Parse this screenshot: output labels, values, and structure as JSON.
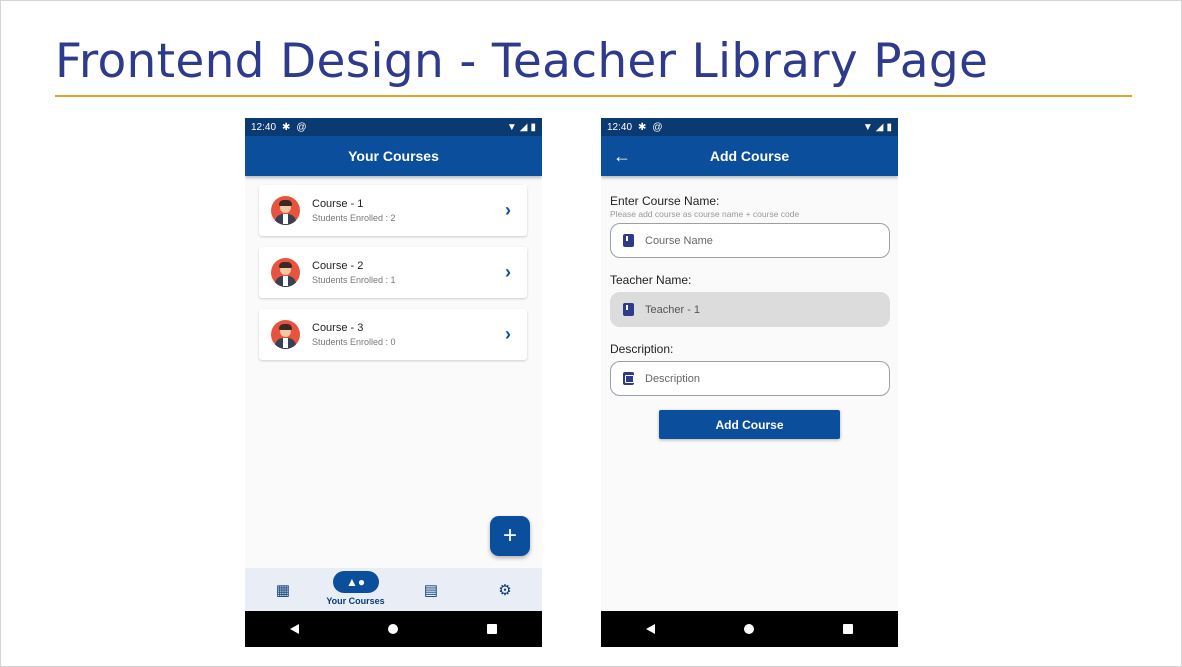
{
  "slide": {
    "title": "Frontend Design - Teacher Library Page",
    "accent_color": "#e2a22a",
    "title_color": "#2e3a8c"
  },
  "status_bar": {
    "time": "12:40",
    "icons": [
      "gear-icon",
      "at-icon",
      "wifi-icon",
      "signal-icon",
      "battery-icon"
    ]
  },
  "courses_screen": {
    "title": "Your Courses",
    "courses": [
      {
        "name": "Course - 1",
        "enrolled": "Students Enrolled : 2"
      },
      {
        "name": "Course - 2",
        "enrolled": "Students Enrolled : 1"
      },
      {
        "name": "Course - 3",
        "enrolled": "Students Enrolled : 0"
      }
    ],
    "fab_label": "+",
    "bottom_nav": {
      "items": [
        {
          "icon": "dashboard-icon",
          "label": ""
        },
        {
          "icon": "shapes-icon",
          "label": "Your Courses",
          "active": true
        },
        {
          "icon": "chat-icon",
          "label": ""
        },
        {
          "icon": "settings-icon",
          "label": ""
        }
      ]
    }
  },
  "add_course_screen": {
    "title": "Add Course",
    "course_name_label": "Enter Course Name:",
    "course_name_hint": "Please add course as course name + course code",
    "course_name_placeholder": "Course Name",
    "teacher_label": "Teacher Name:",
    "teacher_value": "Teacher - 1",
    "description_label": "Description:",
    "description_placeholder": "Description",
    "submit_label": "Add Course"
  },
  "colors": {
    "app_bar": "#0b4f9c",
    "status_bar": "#0b3a73"
  }
}
